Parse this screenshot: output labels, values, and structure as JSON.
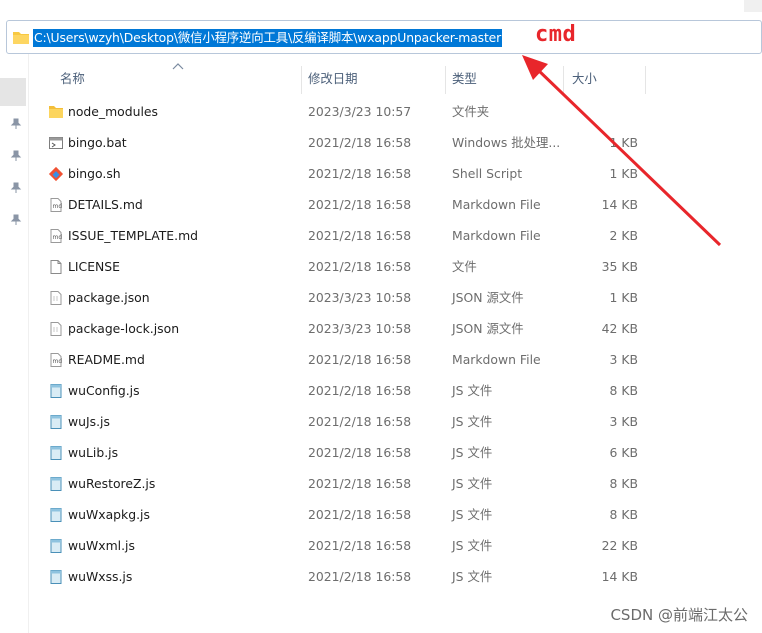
{
  "address_bar": {
    "path": "C:\\Users\\wzyh\\Desktop\\微信小程序逆向工具\\反编译脚本\\wxappUnpacker-master"
  },
  "annotation": {
    "label": "cmd",
    "color": "#e8262b"
  },
  "columns": {
    "name": "名称",
    "date": "修改日期",
    "type": "类型",
    "size": "大小"
  },
  "files": [
    {
      "name": "node_modules",
      "date": "2023/3/23 10:57",
      "type": "文件夹",
      "size": "",
      "icon": "folder-icon"
    },
    {
      "name": "bingo.bat",
      "date": "2021/2/18 16:58",
      "type": "Windows 批处理...",
      "size": "1 KB",
      "icon": "batch-file-icon"
    },
    {
      "name": "bingo.sh",
      "date": "2021/2/18 16:58",
      "type": "Shell Script",
      "size": "1 KB",
      "icon": "git-script-icon"
    },
    {
      "name": "DETAILS.md",
      "date": "2021/2/18 16:58",
      "type": "Markdown File",
      "size": "14 KB",
      "icon": "markdown-file-icon"
    },
    {
      "name": "ISSUE_TEMPLATE.md",
      "date": "2021/2/18 16:58",
      "type": "Markdown File",
      "size": "2 KB",
      "icon": "markdown-file-icon"
    },
    {
      "name": "LICENSE",
      "date": "2021/2/18 16:58",
      "type": "文件",
      "size": "35 KB",
      "icon": "blank-file-icon"
    },
    {
      "name": "package.json",
      "date": "2023/3/23 10:58",
      "type": "JSON 源文件",
      "size": "1 KB",
      "icon": "json-file-icon"
    },
    {
      "name": "package-lock.json",
      "date": "2023/3/23 10:58",
      "type": "JSON 源文件",
      "size": "42 KB",
      "icon": "json-file-icon"
    },
    {
      "name": "README.md",
      "date": "2021/2/18 16:58",
      "type": "Markdown File",
      "size": "3 KB",
      "icon": "markdown-file-icon"
    },
    {
      "name": "wuConfig.js",
      "date": "2021/2/18 16:58",
      "type": "JS 文件",
      "size": "8 KB",
      "icon": "js-file-icon"
    },
    {
      "name": "wuJs.js",
      "date": "2021/2/18 16:58",
      "type": "JS 文件",
      "size": "3 KB",
      "icon": "js-file-icon"
    },
    {
      "name": "wuLib.js",
      "date": "2021/2/18 16:58",
      "type": "JS 文件",
      "size": "6 KB",
      "icon": "js-file-icon"
    },
    {
      "name": "wuRestoreZ.js",
      "date": "2021/2/18 16:58",
      "type": "JS 文件",
      "size": "8 KB",
      "icon": "js-file-icon"
    },
    {
      "name": "wuWxapkg.js",
      "date": "2021/2/18 16:58",
      "type": "JS 文件",
      "size": "8 KB",
      "icon": "js-file-icon"
    },
    {
      "name": "wuWxml.js",
      "date": "2021/2/18 16:58",
      "type": "JS 文件",
      "size": "22 KB",
      "icon": "js-file-icon"
    },
    {
      "name": "wuWxss.js",
      "date": "2021/2/18 16:58",
      "type": "JS 文件",
      "size": "14 KB",
      "icon": "js-file-icon"
    }
  ],
  "watermark": "CSDN @前端江太公"
}
